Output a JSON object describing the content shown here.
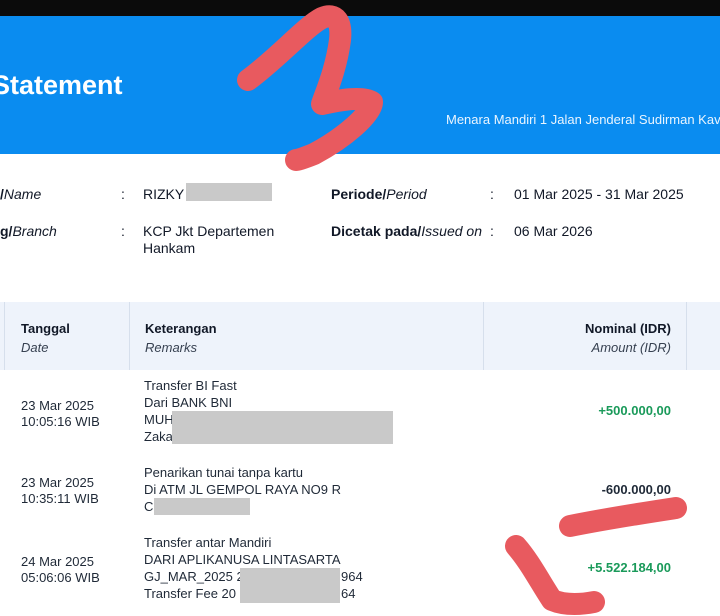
{
  "header": {
    "title": "Statement",
    "address": "Menara Mandiri 1 Jalan Jenderal Sudirman Kav"
  },
  "info": {
    "name_label_id": "/",
    "name_label_en": "Name",
    "name_value": "RIZKY I",
    "branch_label_id": "g/",
    "branch_label_en": "Branch",
    "branch_value_line1": "KCP Jkt Departemen",
    "branch_value_line2": "Hankam",
    "period_label_id": "Periode/",
    "period_label_en": "Period",
    "period_value": "01 Mar 2025 - 31 Mar 2025",
    "printed_label_id": "Dicetak pada/",
    "printed_label_en": "Issued on",
    "printed_value": "06 Mar 2026",
    "colon": ":"
  },
  "table": {
    "col_date_id": "Tanggal",
    "col_date_en": "Date",
    "col_remarks_id": "Keterangan",
    "col_remarks_en": "Remarks",
    "col_amount_id": "Nominal (IDR)",
    "col_amount_en": "Amount (IDR)",
    "rows": [
      {
        "date": "23 Mar 2025",
        "time": "10:05:16 WIB",
        "remarks": [
          "Transfer BI Fast",
          "Dari BANK BNI",
          "MUH",
          "Zaka"
        ],
        "amount": "+500.000,00",
        "type": "credit"
      },
      {
        "date": "23 Mar 2025",
        "time": "10:35:11 WIB",
        "remarks": [
          "Penarikan tunai tanpa kartu",
          "Di ATM JL GEMPOL RAYA NO9 R",
          "C"
        ],
        "amount": "-600.000,00",
        "type": "debit"
      },
      {
        "date": "24 Mar 2025",
        "time": "05:06:06 WIB",
        "remarks": [
          "Transfer antar Mandiri",
          "DARI APLIKANUSA LINTASARTA",
          "GJ_MAR_2025 2",
          "Transfer Fee 20"
        ],
        "remarks_tail": [
          "964",
          "64"
        ],
        "amount": "+5.522.184,00",
        "type": "credit"
      }
    ]
  },
  "colors": {
    "header_blue": "#0a8cf0",
    "credit_green": "#1a9a5a",
    "scribble_red": "#e85a5f"
  }
}
